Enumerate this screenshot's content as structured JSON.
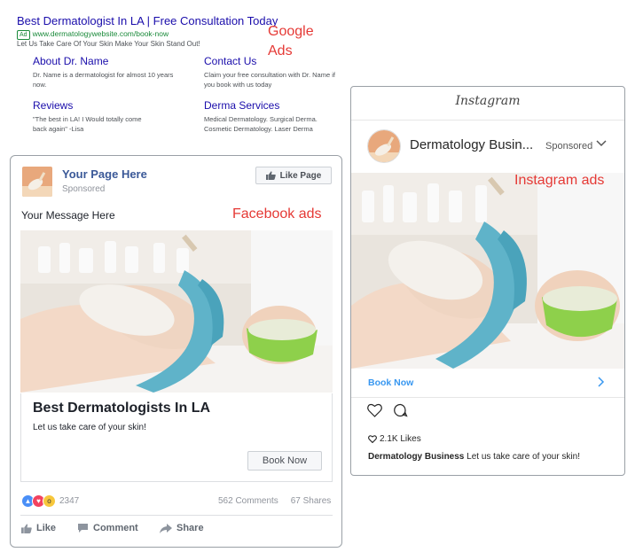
{
  "google_ad": {
    "title": "Best Dermatologist In LA | Free Consultation Today",
    "ad_badge": "Ad",
    "url": "www.dermatologywebsite.com/book-now",
    "description": "Let Us Take Care Of Your Skin Make Your Skin Stand Out!",
    "sitelinks": [
      {
        "title": "About Dr. Name",
        "text": "Dr. Name is a dermatologist for almost 10 years now."
      },
      {
        "title": "Contact Us",
        "text": "Claim your free consultation with Dr. Name if you book with us today"
      },
      {
        "title": "Reviews",
        "text": "\"The best in LA! I Would totally come back again\" -Lisa"
      },
      {
        "title": "Derma Services",
        "text": "Medical Dermatology. Surgical Derma. Cosmetic Dermatology. Laser Derma"
      }
    ]
  },
  "labels": {
    "google": "Google Ads",
    "facebook": "Facebook ads",
    "instagram": "Instagram ads"
  },
  "facebook_ad": {
    "page_name": "Your Page Here",
    "sponsored": "Sponsored",
    "like_page": "Like Page",
    "message": "Your Message Here",
    "headline": "Best Dermatologists In LA",
    "description": "Let us take care of your skin!",
    "cta": "Book Now",
    "reaction_count": "2347",
    "comments": "562 Comments",
    "shares": "67 Shares",
    "actions": {
      "like": "Like",
      "comment": "Comment",
      "share": "Share"
    }
  },
  "instagram_ad": {
    "logo": "Instagram",
    "account_name": "Dermatology Busin...",
    "sponsored": "Sponsored",
    "cta": "Book Now",
    "likes": "2.1K Likes",
    "caption_account": "Dermatology Business",
    "caption_text": "Let us take care of your skin!"
  },
  "colors": {
    "google_link": "#1a0dab",
    "google_url": "#1a8a3a",
    "label_red": "#e53935",
    "facebook_blue": "#3b5998",
    "instagram_blue": "#3897f0"
  }
}
